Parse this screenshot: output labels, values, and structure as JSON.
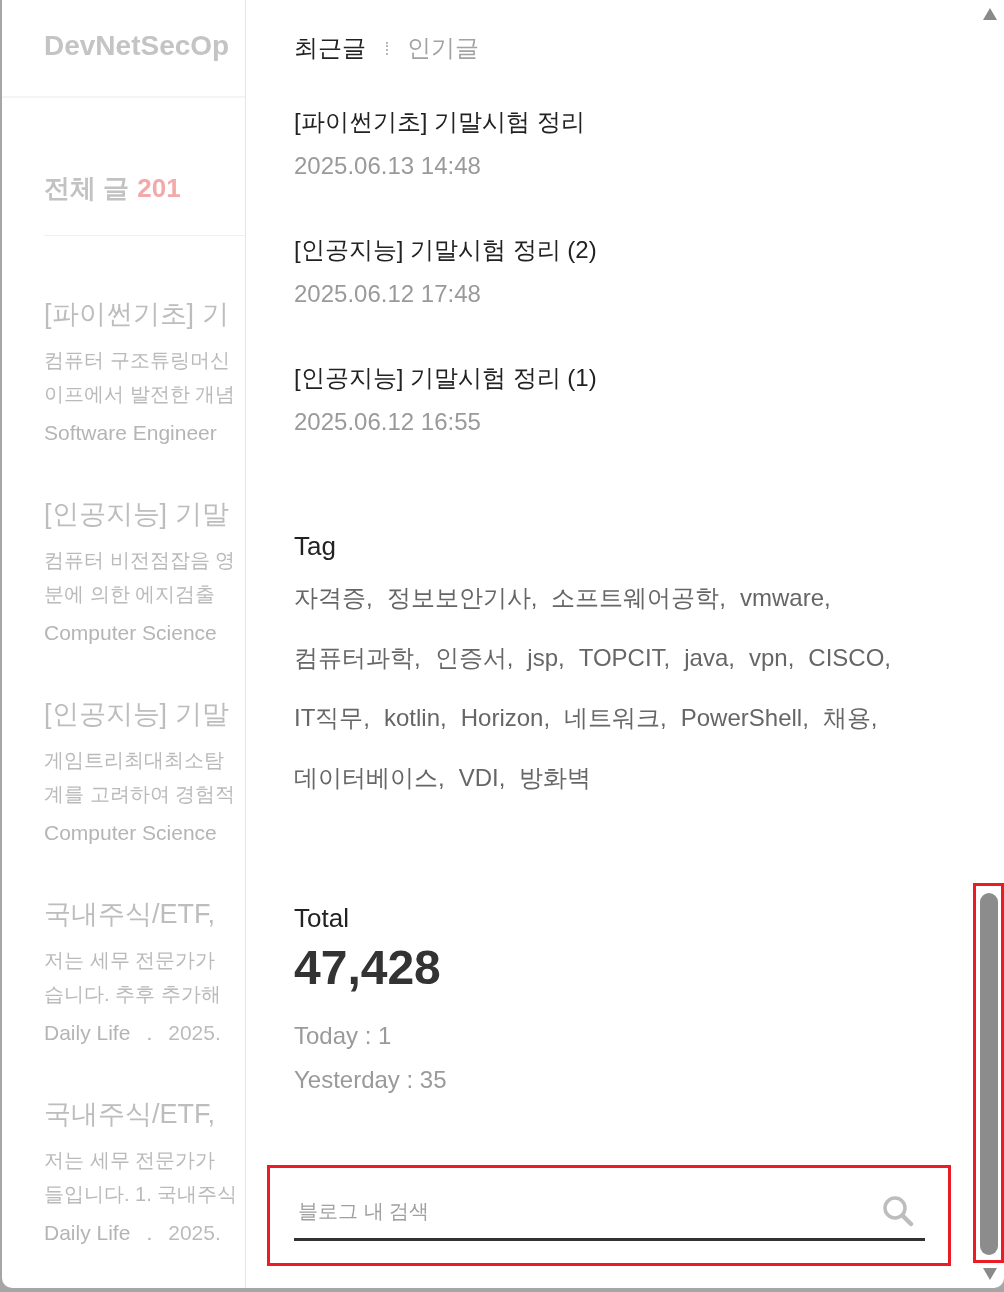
{
  "background_page": {
    "blog_title": "DevNetSecOp",
    "post_count": {
      "label": "전체 글",
      "count": "201"
    },
    "posts": [
      {
        "title": "[파이썬기초] 기",
        "excerpt": "컴퓨터 구조튜링머신\n이프에서 발전한 개념",
        "meta": [
          {
            "kind": "category",
            "text": "Software Engineer"
          }
        ]
      },
      {
        "title": "[인공지능] 기말",
        "excerpt": "컴퓨터 비전점잡음 영\n분에 의한 에지검출",
        "meta": [
          {
            "kind": "category",
            "text": "Computer Science"
          }
        ]
      },
      {
        "title": "[인공지능] 기말",
        "excerpt": "게임트리최대최소탐\n계를 고려하여 경험적",
        "meta": [
          {
            "kind": "category",
            "text": "Computer Science"
          }
        ]
      },
      {
        "title": "국내주식/ETF,",
        "excerpt": "저는 세무 전문가가\n습니다. 추후 추가해",
        "meta": [
          {
            "kind": "category",
            "text": "Daily Life"
          },
          {
            "kind": "separator",
            "text": "."
          },
          {
            "kind": "date",
            "text": "2025."
          }
        ]
      },
      {
        "title": "국내주식/ETF,",
        "excerpt": "저는 세무 전문가가\n들입니다. 1. 국내주식",
        "meta": [
          {
            "kind": "category",
            "text": "Daily Life"
          },
          {
            "kind": "separator",
            "text": "."
          },
          {
            "kind": "date",
            "text": "2025."
          }
        ]
      }
    ]
  },
  "drawer": {
    "tabs": [
      {
        "label": "최근글",
        "selected": true
      },
      {
        "label": "인기글",
        "selected": false
      }
    ],
    "recent_posts": [
      {
        "title": "[파이썬기초] 기말시험 정리",
        "date": "2025.06.13 14:48"
      },
      {
        "title": "[인공지능] 기말시험 정리 (2)",
        "date": "2025.06.12 17:48"
      },
      {
        "title": "[인공지능] 기말시험 정리 (1)",
        "date": "2025.06.12 16:55"
      }
    ],
    "tags": {
      "heading": "Tag",
      "items": [
        "자격증,",
        "정보보안기사,",
        "소프트웨어공학,",
        "vmware,",
        "컴퓨터과학,",
        "인증서,",
        "jsp,",
        "TOPCIT,",
        "java,",
        "vpn,",
        "CISCO,",
        "IT직무,",
        "kotlin,",
        "Horizon,",
        "네트워크,",
        "PowerShell,",
        "채용,",
        "데이터베이스,",
        "VDI,",
        "방화벽"
      ]
    },
    "visits": {
      "label": "Total",
      "total": "47,428",
      "lines": [
        "Today : 1",
        "Yesterday : 35"
      ]
    },
    "search": {
      "placeholder": "블로그 내 검색",
      "highlighted": true
    }
  },
  "scrollbar": {
    "highlighted": true
  }
}
